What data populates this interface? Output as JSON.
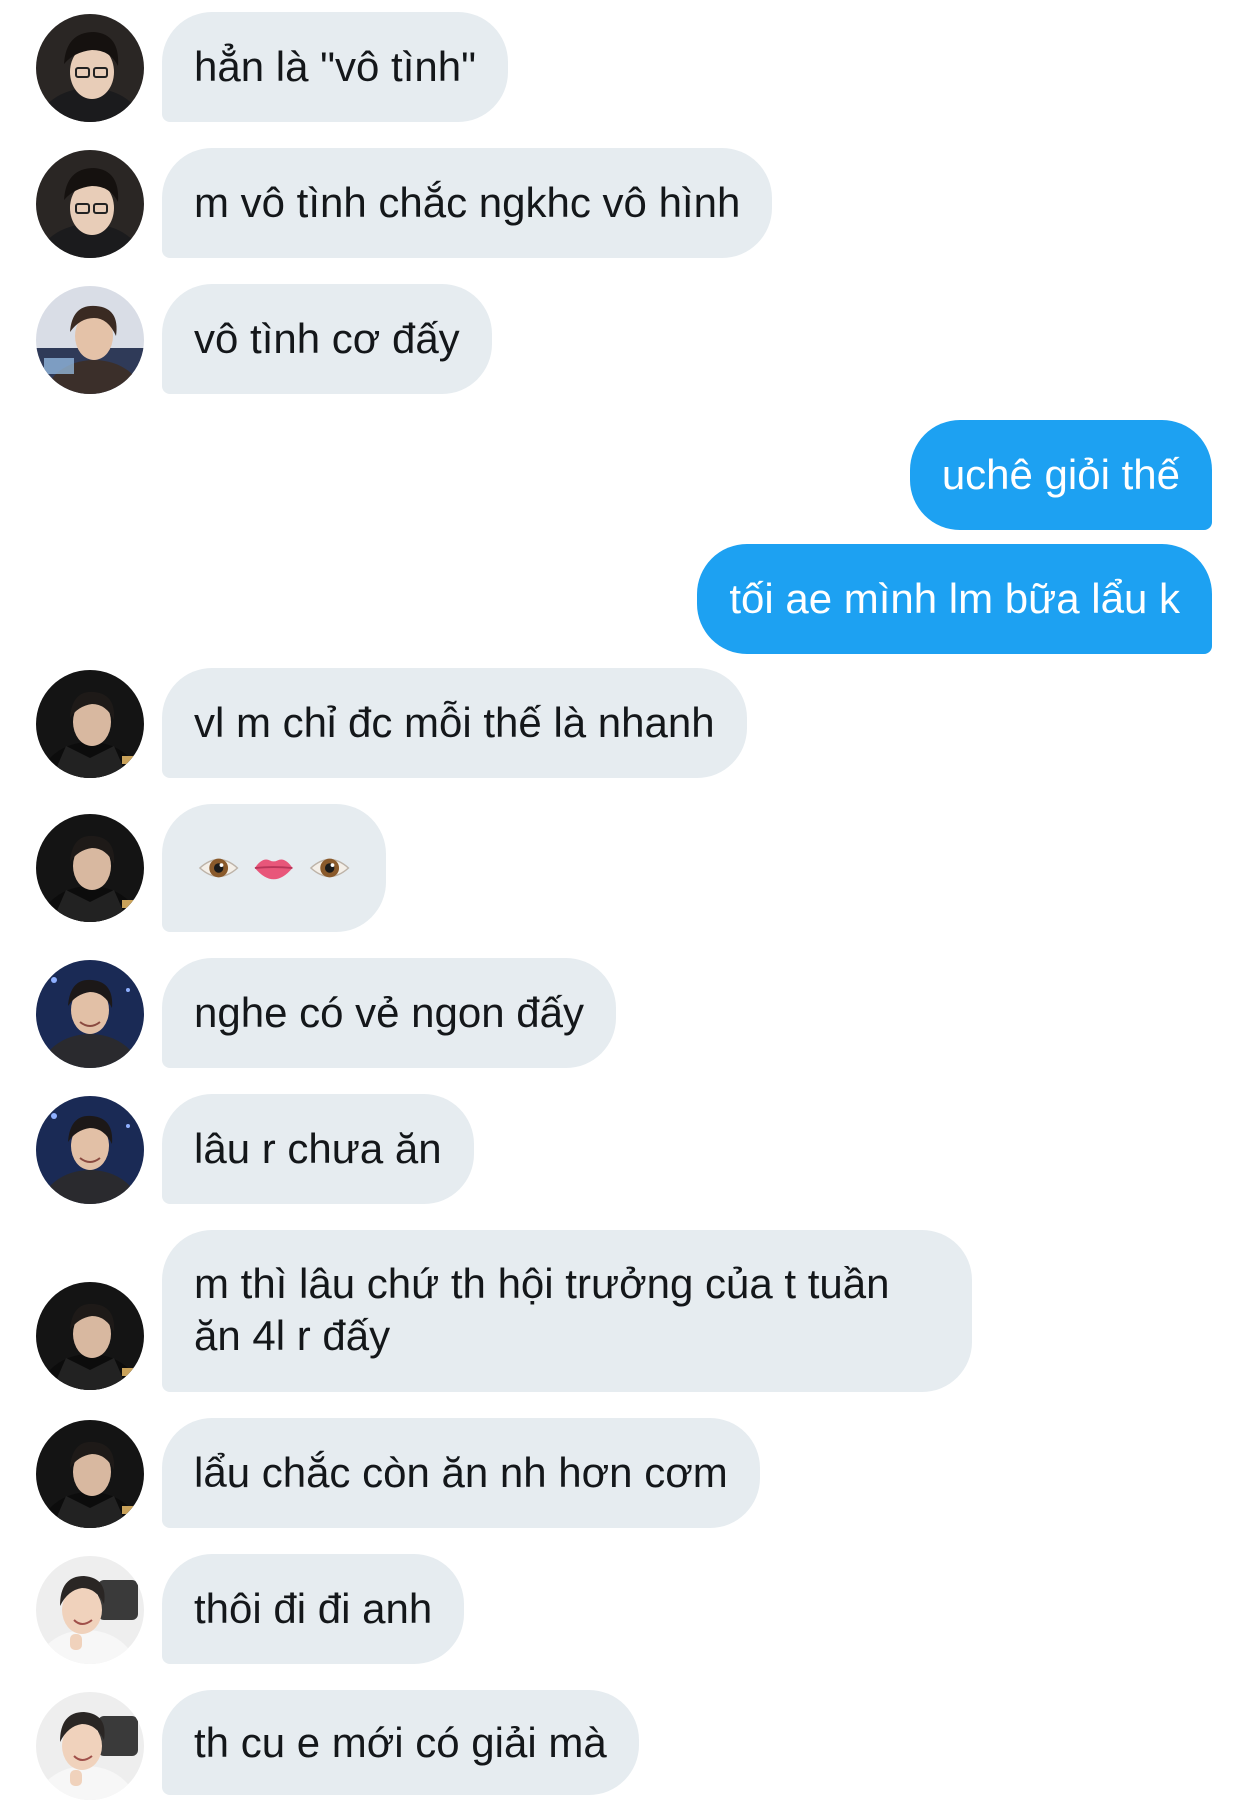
{
  "messages": [
    {
      "sender": "them",
      "avatar": "avatar-boy-glasses",
      "text": "hẳn là \"vô tình\""
    },
    {
      "sender": "them",
      "avatar": "avatar-boy-glasses",
      "text": "m vô tình chắc ngkhc vô hình"
    },
    {
      "sender": "them",
      "avatar": "avatar-boy-stage",
      "text": "vô tình cơ đấy"
    },
    {
      "sender": "me",
      "text": "uchê giỏi thế"
    },
    {
      "sender": "me",
      "text": "tối ae mình lm bữa lẩu k"
    },
    {
      "sender": "them",
      "avatar": "avatar-boy-jacket",
      "text": "vl m chỉ đc mỗi thế là nhanh"
    },
    {
      "sender": "them",
      "avatar": "avatar-boy-jacket",
      "emoji": [
        "eye-icon",
        "lips-icon",
        "eye-icon"
      ]
    },
    {
      "sender": "them",
      "avatar": "avatar-boy-smile",
      "text": "nghe có vẻ ngon đấy"
    },
    {
      "sender": "them",
      "avatar": "avatar-boy-smile",
      "text": "lâu r chưa ăn"
    },
    {
      "sender": "them",
      "avatar": "avatar-boy-jacket",
      "text": "m thì lâu chứ th hội trưởng của t tuần ăn 4l r đấy"
    },
    {
      "sender": "them",
      "avatar": "avatar-boy-jacket",
      "text": "lẩu chắc còn ăn nh hơn cơm"
    },
    {
      "sender": "them",
      "avatar": "avatar-boy-white",
      "text": "thôi đi đi anh"
    },
    {
      "sender": "them",
      "avatar": "avatar-boy-white",
      "text": "th cu e mới có giải mà"
    }
  ],
  "colors": {
    "incoming_bubble": "#e6ecf0",
    "outgoing_bubble": "#1da1f2",
    "incoming_text": "#14171a",
    "outgoing_text": "#ffffff"
  }
}
